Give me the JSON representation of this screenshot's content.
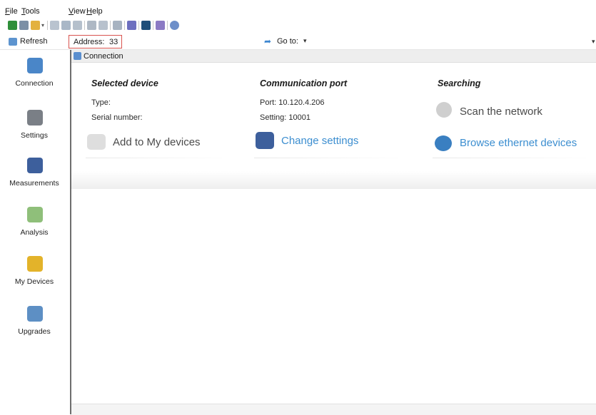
{
  "menu": {
    "file": {
      "u": "F",
      "rest": "ile"
    },
    "tools": {
      "u": "T",
      "rest": "ools"
    },
    "view": {
      "u": "V",
      "rest": "iew"
    },
    "help": {
      "u": "H",
      "rest": "elp"
    }
  },
  "toolbar_icons": [
    "new-device-icon",
    "print-icon",
    "open-folder-icon",
    "dropdown-arrow",
    "copy-icon",
    "save-icon",
    "export-icon",
    "print-preview-icon",
    "report-icon",
    "book-icon",
    "probe-icon",
    "monitor-icon",
    "cable-icon",
    "globe-icon"
  ],
  "addressbar": {
    "refresh_label": "Refresh",
    "address_key": "Address:",
    "address_value": "33",
    "goto_label": "Go to:"
  },
  "sidebar": {
    "items": [
      {
        "label": "Connection",
        "icon": "computer-icon",
        "color": "#4a86c8"
      },
      {
        "label": "Settings",
        "icon": "settings-wrench-icon",
        "color": "#7a7f86"
      },
      {
        "label": "Measurements",
        "icon": "gauge-icon",
        "color": "#3d5f9c"
      },
      {
        "label": "Analysis",
        "icon": "chart-analysis-icon",
        "color": "#8fbf7a"
      },
      {
        "label": "My Devices",
        "icon": "my-devices-star-icon",
        "color": "#e3b32a"
      },
      {
        "label": "Upgrades",
        "icon": "upgrade-disc-icon",
        "color": "#5d8fc4"
      }
    ]
  },
  "connection_header": "Connection",
  "selected_device": {
    "title": "Selected device",
    "type_label": "Type:",
    "serial_label": "Serial number:",
    "add_label": "Add to My devices"
  },
  "communication_port": {
    "title": "Communication port",
    "port_line": "Port: 10.120.4.206",
    "setting_line": "Setting: 10001",
    "change_label": "Change settings"
  },
  "searching": {
    "title": "Searching",
    "scan_label": "Scan the network",
    "browse_label": "Browse ethernet devices"
  },
  "colors": {
    "link": "#3c8ed0",
    "highlight_border": "#d9534f",
    "sidebar_border": "#6e6e6e"
  }
}
